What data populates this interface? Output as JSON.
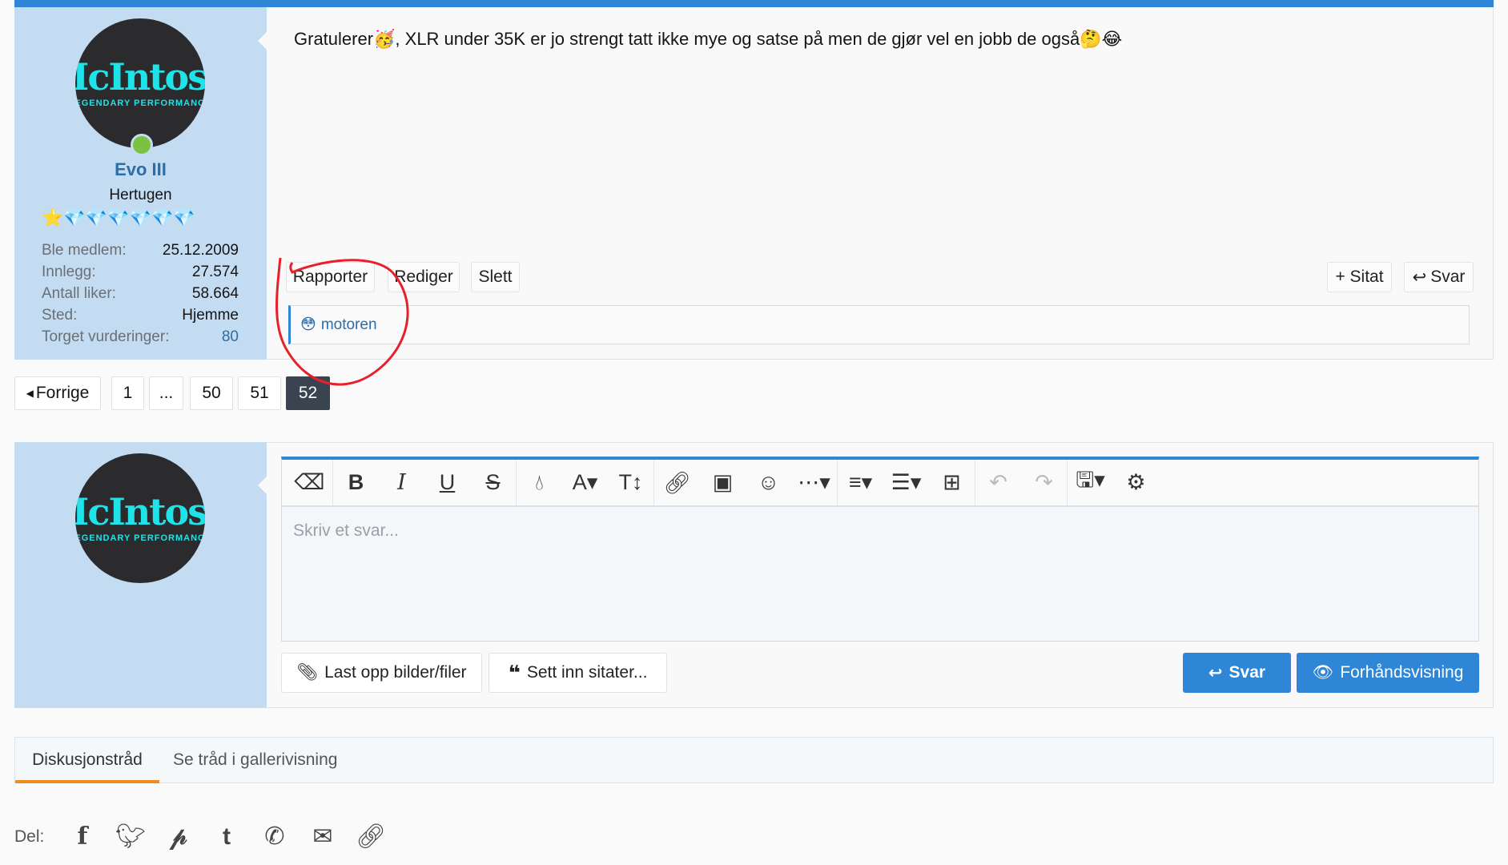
{
  "post": {
    "message": "Gratulerer🥳, XLR under 35K er jo strengt tatt ikke mye og satse på men de gjør vel en jobb de også🤔😂",
    "user": {
      "name": "Evo III",
      "title": "Hertugen",
      "avatar_text": "McIntosh",
      "avatar_sub": "LEGENDARY PERFORMANCE",
      "badges": "⭐💎💎💎💎💎💎",
      "stats": [
        {
          "k": "Ble medlem:",
          "v": "25.12.2009"
        },
        {
          "k": "Innlegg:",
          "v": "27.574"
        },
        {
          "k": "Antall liker:",
          "v": "58.664"
        },
        {
          "k": "Sted:",
          "v": "Hjemme"
        },
        {
          "k": "Torget vurderinger:",
          "v": "80"
        }
      ]
    },
    "actions": {
      "report": "Rapporter",
      "edit": "Rediger",
      "delete": "Slett",
      "quote": "+ Sitat",
      "reply": "Svar"
    },
    "reaction": {
      "emoji": "😳",
      "user": "motoren"
    }
  },
  "pagination": {
    "prev": "Forrige",
    "pages": [
      "1",
      "...",
      "50",
      "51",
      "52"
    ],
    "current": "52"
  },
  "editor": {
    "placeholder": "Skriv et svar...",
    "upload": "Last opp bilder/filer",
    "insert_quotes": "Sett inn sitater...",
    "reply": "Svar",
    "preview": "Forhåndsvisning"
  },
  "tabs": [
    "Diskusjonstråd",
    "Se tråd i gallerivisning"
  ],
  "share": {
    "label": "Del:"
  },
  "colors": {
    "accent": "#2f86d6",
    "active_tab": "#f08c1e",
    "annotation": "#e8202a"
  }
}
